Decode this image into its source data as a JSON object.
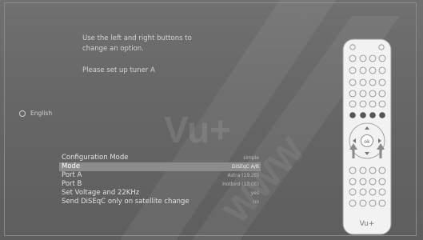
{
  "instructions": {
    "line1": "Use the left and right buttons to",
    "line2": "change an option.",
    "line3": "Please set up tuner A"
  },
  "language": {
    "label": "English"
  },
  "config": {
    "rows": [
      {
        "label": "Configuration Mode",
        "value": "simple"
      },
      {
        "label": "Mode",
        "value": "DiSEqC A/B"
      },
      {
        "label": "Port A",
        "value": "Astra (19.2E)"
      },
      {
        "label": "Port B",
        "value": "Hotbird (13.0E)"
      },
      {
        "label": "Set Voltage and 22KHz",
        "value": "yes"
      },
      {
        "label": "Send DiSEqC only on satellite change",
        "value": "no"
      }
    ],
    "selected_index": 1
  },
  "watermark": {
    "text": "Vu+",
    "diagonal_text": "WWW"
  },
  "remote": {
    "brand": "Vu+"
  },
  "colors": {
    "background": "#6a6a6a",
    "selection": "#8c8c8c",
    "text": "#e2e2e2"
  }
}
